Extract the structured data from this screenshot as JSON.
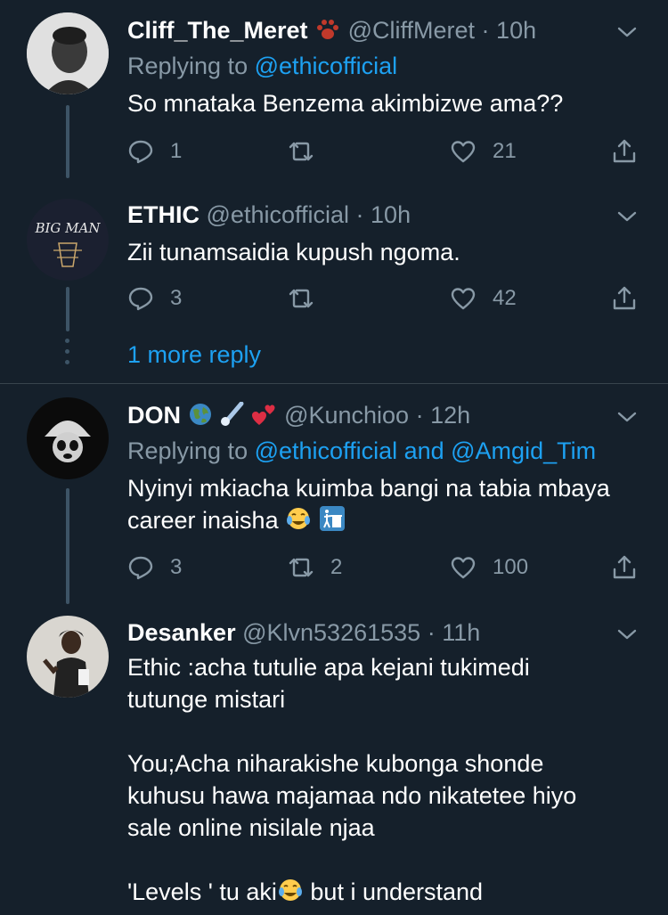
{
  "tweets": [
    {
      "name": "Cliff_The_Meret",
      "handle": "@CliffMeret",
      "sep": "·",
      "time": "10h",
      "replying_prefix": "Replying to",
      "replying_to": "@ethicofficial",
      "text": "So mnataka Benzema akimbizwe ama??",
      "reply_count": "1",
      "retweet_count": "",
      "like_count": "21"
    },
    {
      "name": "ETHIC",
      "handle": "@ethicofficial",
      "sep": "·",
      "time": "10h",
      "avatar_text": "BIG MAN",
      "text": "Zii tunamsaidia kupush ngoma.",
      "reply_count": "3",
      "retweet_count": "",
      "like_count": "42"
    },
    {
      "name": "DON",
      "handle": "@Kunchioo",
      "sep": "·",
      "time": "12h",
      "replying_prefix": "Replying to",
      "replying_to": "@ethicofficial and @Amgid_Tim",
      "text_line1": "Nyinyi mkiacha kuimba bangi na tabia mbaya",
      "text_line2": "career inaisha",
      "reply_count": "3",
      "retweet_count": "2",
      "like_count": "100"
    },
    {
      "name": "Desanker",
      "handle": "@Klvn53261535",
      "sep": "·",
      "time": "11h",
      "para1_line1": "Ethic :acha tutulie apa kejani tukimedi",
      "para1_line2": "tutunge mistari",
      "para2_line1": "You;Acha niharakishe kubonga shonde",
      "para2_line2": "kuhusu hawa majamaa ndo nikatetee hiyo",
      "para2_line3": "sale online nisilale njaa",
      "para3_start": "'Levels ' tu aki",
      "para3_end": " but i understand"
    }
  ],
  "more_replies_label": "1 more reply",
  "colors": {
    "background": "#15202b",
    "text": "#ffffff",
    "secondary": "#8899a6",
    "link": "#1da1f2",
    "thread_line": "#3d5466"
  }
}
